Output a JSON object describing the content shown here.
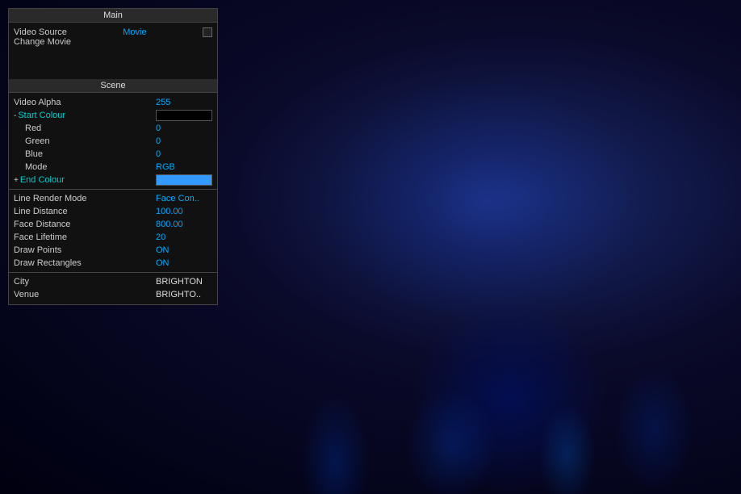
{
  "background": {
    "description": "Concert crowd with blue lighting"
  },
  "panel": {
    "main_header": "Main",
    "scene_header": "Scene",
    "video_source": {
      "label": "Video Source",
      "value": "Movie",
      "change_label": "Change Movie"
    },
    "scene_fields": {
      "video_alpha": {
        "label": "Video Alpha",
        "value": "255"
      },
      "start_colour": {
        "label": "Start Colour",
        "prefix": "-"
      },
      "red": {
        "label": "Red",
        "value": "0"
      },
      "green": {
        "label": "Green",
        "value": "0"
      },
      "blue": {
        "label": "Blue",
        "value": "0"
      },
      "mode": {
        "label": "Mode",
        "value": "RGB"
      },
      "end_colour": {
        "label": "End Colour",
        "prefix": "+"
      },
      "line_render_mode": {
        "label": "Line Render Mode",
        "value": "Face Con.."
      },
      "line_distance": {
        "label": "Line Distance",
        "value": "100.00"
      },
      "face_distance": {
        "label": "Face Distance",
        "value": "800.00"
      },
      "face_lifetime": {
        "label": "Face Lifetime",
        "value": "20"
      },
      "draw_points": {
        "label": "Draw Points",
        "value": "ON"
      },
      "draw_rectangles": {
        "label": "Draw Rectangles",
        "value": "ON"
      },
      "city": {
        "label": "City",
        "value": "BRIGHTON"
      },
      "venue": {
        "label": "Venue",
        "value": "BRIGHTO.."
      }
    }
  }
}
